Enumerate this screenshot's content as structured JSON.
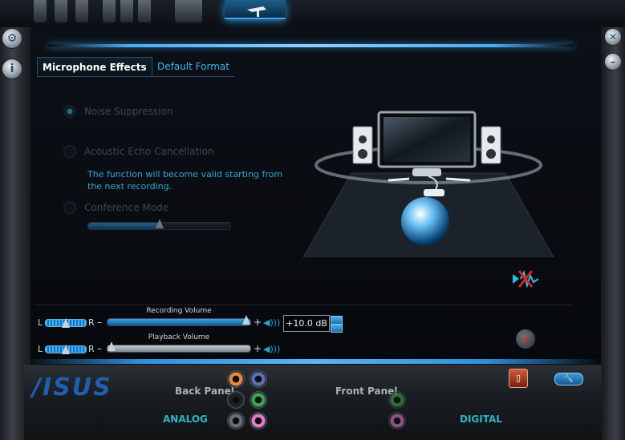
{
  "tabs": {
    "microphone_effects": "Microphone Effects",
    "default_format": "Default Format"
  },
  "effects": {
    "noise_suppression": "Noise Suppression",
    "echo_cancellation": "Acoustic Echo Cancellation",
    "echo_note": "The function will become valid starting from the next recording.",
    "conference_mode": "Conference Mode",
    "conference_slider_level": 0.5
  },
  "volume": {
    "recording_label": "Recording Volume",
    "playback_label": "Playback Volume",
    "left": "L",
    "right": "R",
    "minus": "–",
    "plus": "+",
    "recording_level": 1.0,
    "playback_level": 0.0,
    "recording_db": "+10.0 dB",
    "balance_rec": 0.5,
    "balance_play": 0.5
  },
  "bottom": {
    "brand": "/ISUS",
    "back_panel": "Back Panel",
    "front_panel": "Front Panel",
    "analog": "ANALOG",
    "digital": "DIGITAL"
  },
  "colors": {
    "accent": "#37b4e4",
    "jack_orange": "#e8873a",
    "jack_blue": "#5b6fb8",
    "jack_black": "#1c1f22",
    "jack_green": "#3aa84a",
    "jack_gray": "#6b7076",
    "jack_pink": "#e27cc8"
  }
}
